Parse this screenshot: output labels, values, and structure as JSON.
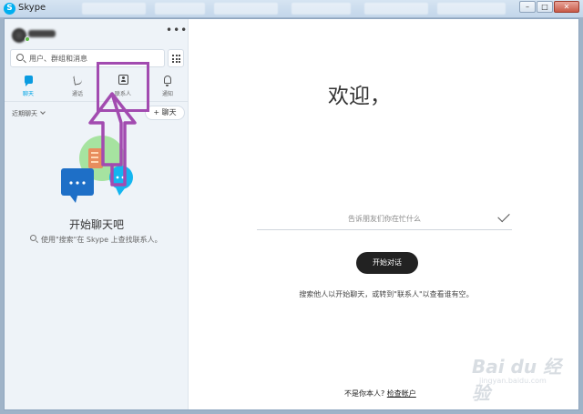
{
  "window": {
    "title": "Skype",
    "logo_letter": "S",
    "buttons": [
      "–",
      "□",
      "✕"
    ]
  },
  "sidebar": {
    "more_label": "•••",
    "search": {
      "placeholder": "用户、群组和消息"
    },
    "tabs": [
      {
        "label": "聊天",
        "icon": "chat-icon",
        "active": true
      },
      {
        "label": "通话",
        "icon": "phone-icon",
        "active": false
      },
      {
        "label": "联系人",
        "icon": "contacts-icon",
        "active": false
      },
      {
        "label": "通知",
        "icon": "bell-icon",
        "active": false
      }
    ],
    "recent_label": "近期聊天",
    "new_chat_label": "+ 聊天",
    "empty_state": {
      "title": "开始聊天吧",
      "hint": "使用\"搜索\"在 Skype 上查找联系人。"
    }
  },
  "main": {
    "welcome": "欢迎，",
    "mood_placeholder": "告诉朋友们你在忙什么",
    "start_button": "开始对话",
    "search_hint": "搜索他人以开始聊天，或转到\"联系人\"以查看谁有空。",
    "not_you_prefix": "不是你本人?",
    "check_account": "检查帐户"
  },
  "watermark": {
    "brand": "Bai du 经验",
    "sub": "jingyan.baidu.com"
  },
  "colors": {
    "accent": "#00aff0",
    "annotation_purple": "#a24bb0",
    "button_dark": "#222222",
    "sidebar_bg": "#eef3f8"
  }
}
